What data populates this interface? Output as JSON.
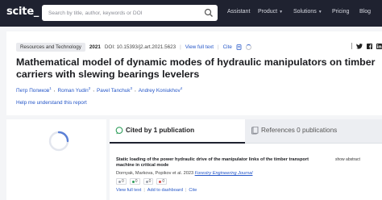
{
  "header": {
    "logo": "scite_",
    "search_placeholder": "Search by title, author, keywords or DOI",
    "nav": [
      {
        "label": "Assistant",
        "dropdown": false
      },
      {
        "label": "Product",
        "dropdown": true
      },
      {
        "label": "Solutions",
        "dropdown": true
      },
      {
        "label": "Pricing",
        "dropdown": false
      },
      {
        "label": "Blog",
        "dropdown": false
      }
    ]
  },
  "article": {
    "tag": "Resources and Technology",
    "year": "2021",
    "doi": "DOI: 10.15393/j2.art.2021.5623",
    "view_full_text": "View full text",
    "cite": "Cite",
    "title": "Mathematical model of dynamic modes of hydraulic manipulators on timber carriers with slewing bearings levelers",
    "authors": [
      {
        "name": "Петр Попиков",
        "sup": "1"
      },
      {
        "name": "Roman Yudin",
        "sup": "2"
      },
      {
        "name": "Pavel Tanchuk",
        "sup": "3"
      },
      {
        "name": "Andrey Koniukhov",
        "sup": "4"
      }
    ],
    "help_link": "Help me understand this report"
  },
  "tabs": {
    "cited_by": "Cited by 1 publication",
    "references": "References 0 publications"
  },
  "citing": {
    "title": "Static loading of the power hydraulic drive of the manipulator links of the timber transport machine in critical mode",
    "show_abstract": "show abstract",
    "authors_line": "Dornyak, Markova, Popikov et al. 2023",
    "journal": "Forestry Engineering Journal",
    "counts": [
      "0",
      "0",
      "0",
      "0"
    ],
    "actions": [
      "View full text",
      "Add to dashboard",
      "Cite"
    ]
  },
  "colors": {
    "topbar": "#1f2230",
    "link": "#2456c8",
    "page_bg": "#f4f5f7"
  }
}
